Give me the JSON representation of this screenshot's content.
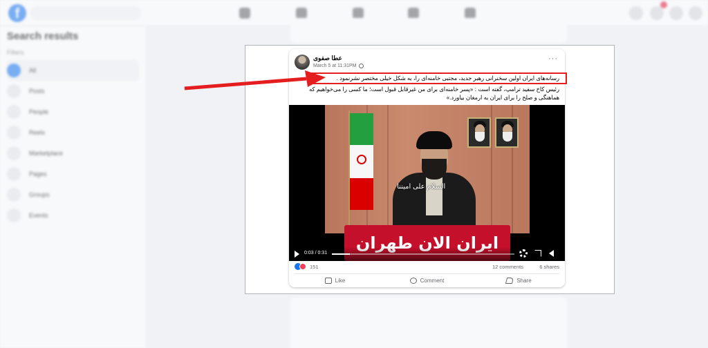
{
  "background": {
    "search_placeholder": "",
    "left_title": "Search results",
    "filters_label": "Filters",
    "filters": [
      "All",
      "Posts",
      "People",
      "Reels",
      "Marketplace",
      "Pages",
      "Groups",
      "Events"
    ]
  },
  "post": {
    "author": "عطا صفوی",
    "date": "March 5 at 11:31PM",
    "more_label": "···",
    "text_line1": "رسانه‌های ایران اولین سخنرانی رهبر جدید، مجتبی خامنه‌ای را، به شکل خیلی مختصر نشرنمود .",
    "text_line2": "رئیس کاخ سفید ترامپ، گفته است : «پسر خامنه‌ای برای من غیرقابل قبول است؛ ما کسی را می‌خواهیم که هماهنگی و صلح را برای ایران به ارمغان بیاورد.»",
    "video": {
      "overlay": "السلام علی امیننا",
      "banner": "ایران الان  طهران",
      "time": "0:03 / 0:31",
      "progress": 0.1
    },
    "reactions_count": "151",
    "comments": "12 comments",
    "shares": "6 shares",
    "actions": {
      "like": "Like",
      "comment": "Comment",
      "share": "Share"
    }
  },
  "colors": {
    "highlight": "#e41e1e",
    "arrow": "#e41e1e",
    "accent": "#1877f2"
  }
}
